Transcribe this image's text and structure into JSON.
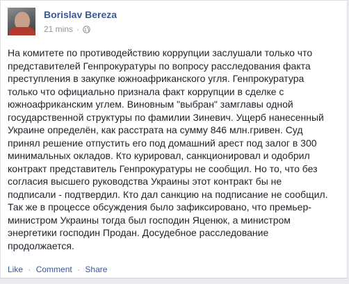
{
  "post": {
    "author": "Borislav Bereza",
    "time": "21 mins",
    "separator": "·",
    "privacy_icon": "globe-icon",
    "text_lines": [
      "На комитете по противодействию коррупции заслушали только что",
      "представителей Генпрокуратуры по вопросу расследования факта",
      "преступления в закупке южноафриканского угля. Генпрокуратура",
      "только что официально признала факт коррупции в сделке с",
      "южноафриканским углем. Виновным \"выбран\" замглавы одной",
      "государственной структуры по фамилии Зиневич. Ущерб нанесенный",
      "Украине определён, как расстрата на сумму 846 млн.гривен. Суд",
      "принял решение отпустить его под домашний арест под залог в 300",
      "минимальных окладов. Кто курировал, санкционировал и одобрил",
      "контракт представитель Генпрокуратуры не сообщил. Но то, что без",
      "согласия высшего руководства Украины этот контракт бы не",
      "подписали - подтвердил. Кто дал санкцию на подписание не сообщил.",
      "Так же в процессе обсуждения было зафиксировано, что премьер-",
      "министром Украины тогда был господин Яценюк, а министром",
      "энергетики господин Продан. Досудебное расследование",
      "продолжается."
    ]
  },
  "actions": {
    "like": "Like",
    "comment": "Comment",
    "share": "Share",
    "separator": "·"
  },
  "colors": {
    "link": "#365899",
    "text": "#1d2129",
    "meta": "#90949c"
  }
}
